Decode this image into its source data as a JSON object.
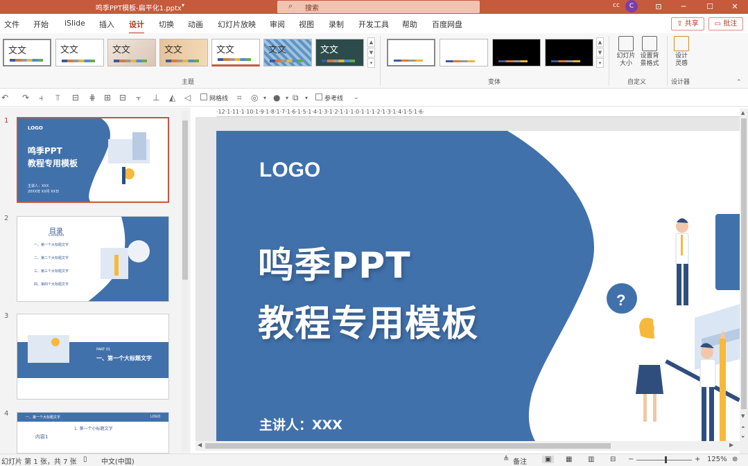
{
  "titlebar": {
    "doc_title": "鸣季PPT模板-扁平化1.pptx",
    "search_placeholder": "搜索",
    "user": "cc",
    "avatar_initial": "C"
  },
  "menu": [
    "文件",
    "开始",
    "iSlide",
    "插入",
    "设计",
    "切换",
    "动画",
    "幻灯片放映",
    "审阅",
    "视图",
    "录制",
    "开发工具",
    "帮助",
    "百度网盘"
  ],
  "menu_active": "设计",
  "actions": {
    "share": "共享",
    "comment": "批注"
  },
  "ribbon": {
    "themes_label": "主题",
    "theme_sample_text": "文文",
    "variants_label": "变体",
    "custom_label": "自定义",
    "designer_label": "设计器",
    "slide_size": "幻灯片\n大小",
    "bg_format": "设置背\n景格式",
    "design_ideas": "设计\n灵感"
  },
  "qat": {
    "gridlines": "网格线",
    "guides": "参考线"
  },
  "thumbnails": [
    {
      "num": "1",
      "logo": "LOGO",
      "title1": "鸣季PPT",
      "title2": "教程专用模板",
      "speaker": "主讲人：XXX",
      "date": "20XX年 XX月 XX日"
    },
    {
      "num": "2",
      "title": "目录",
      "subtitle": "Contents",
      "items": [
        "一、第一个大标题文字",
        "二、第二个大标题文字",
        "三、第三个大标题文字",
        "四、第四个大标题文字"
      ]
    },
    {
      "num": "3",
      "part": "PART 01",
      "title": "一、第一个大标题文字"
    },
    {
      "num": "4",
      "header": "一、第一个大标题文字",
      "logo": "LOGO",
      "subheader": "1. 第一个小标题文字",
      "content": "内容1"
    }
  ],
  "ruler_h": "·12·1·11·1·10·1·9·1·8·1·7·1·6·1·5·1·4·1·3·1·2·1·1·1·0·1·1·1·2·1·3·1·4·1·5·1·6·",
  "ruler_v": [
    "7",
    "6",
    "5",
    "4",
    "3",
    "2",
    "1",
    "0",
    "1",
    "2",
    "3",
    "4",
    "5",
    "6"
  ],
  "slide": {
    "logo": "LOGO",
    "title_line1": "鸣季PPT",
    "title_line2": "教程专用模板",
    "speaker": "主讲人：XXX"
  },
  "status": {
    "slide_info": "幻灯片 第 1 张，共 7 张",
    "language": "中文(中国)",
    "notes": "备注",
    "zoom": "125%"
  },
  "colors": {
    "accent": "#c55a3d",
    "slide_blue": "#4171ab"
  }
}
